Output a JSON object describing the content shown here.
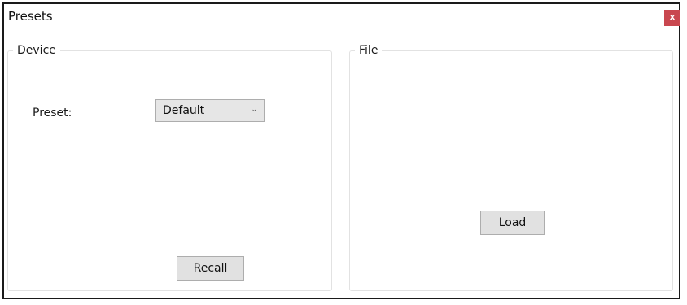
{
  "window": {
    "title": "Presets",
    "close_label": "x"
  },
  "device": {
    "legend": "Device",
    "preset_label": "Preset:",
    "preset_value": "Default",
    "recall_label": "Recall"
  },
  "file": {
    "legend": "File",
    "load_label": "Load"
  },
  "icons": {
    "close": "close-icon",
    "dropdown": "chevron-down-icon"
  },
  "colors": {
    "close_button": "#c9474f",
    "button_face": "#e1e1e1"
  }
}
